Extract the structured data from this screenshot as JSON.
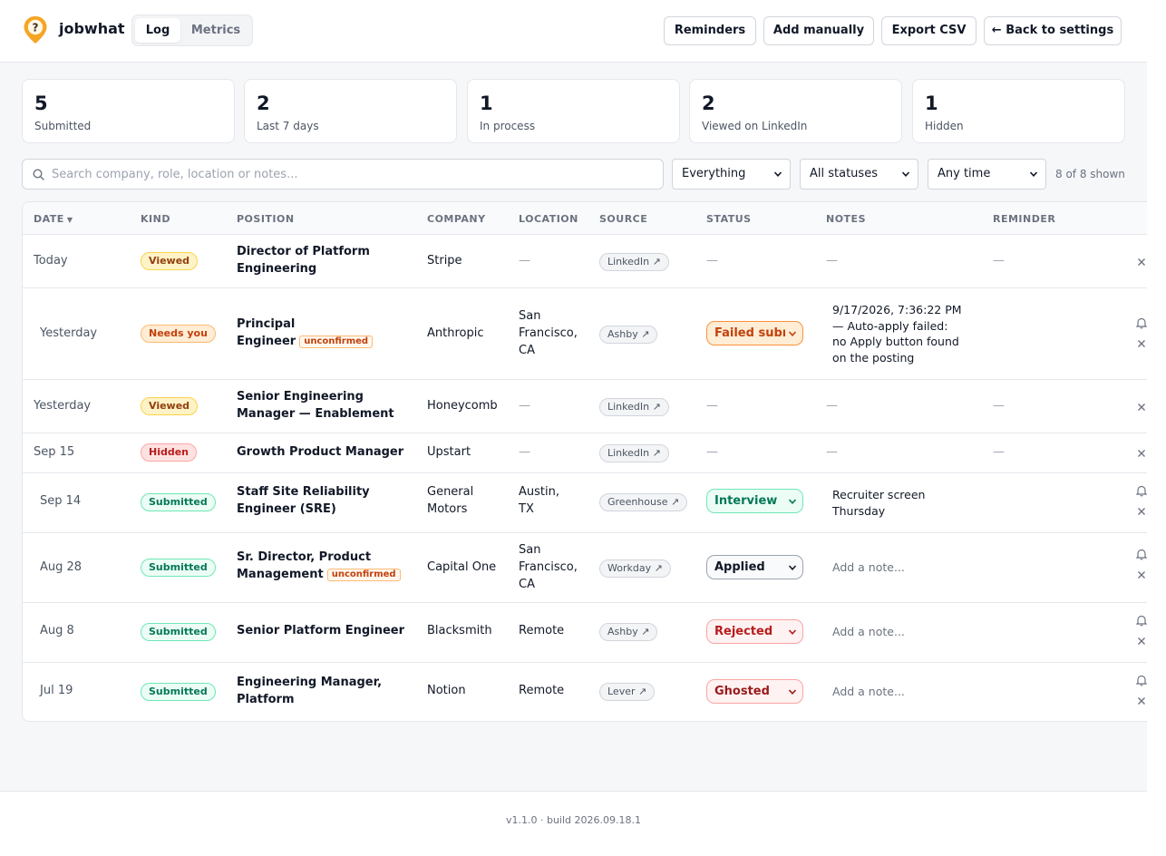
{
  "header": {
    "brand": "jobwhat",
    "tabs": [
      {
        "label": "Log",
        "active": true
      },
      {
        "label": "Metrics",
        "active": false
      }
    ],
    "buttons": {
      "reminders": "Reminders",
      "add_manually": "Add manually",
      "export_csv": "Export CSV",
      "back": "← Back to settings"
    }
  },
  "stats": [
    {
      "value": "5",
      "label": "Submitted"
    },
    {
      "value": "2",
      "label": "Last 7 days"
    },
    {
      "value": "1",
      "label": "In process"
    },
    {
      "value": "2",
      "label": "Viewed on LinkedIn"
    },
    {
      "value": "1",
      "label": "Hidden"
    }
  ],
  "filters": {
    "search_placeholder": "Search company, role, location or notes...",
    "kind": "Everything",
    "status": "All statuses",
    "time": "Any time",
    "shown": "8 of 8 shown"
  },
  "table": {
    "columns": {
      "date": "DATE",
      "kind": "KIND",
      "position": "POSITION",
      "company": "COMPANY",
      "location": "LOCATION",
      "source": "SOURCE",
      "status": "STATUS",
      "notes": "NOTES",
      "reminder": "REMINDER"
    },
    "sort_indicator": "▼",
    "unconfirmed_label": "unconfirmed",
    "dash": "—",
    "rows": [
      {
        "date": "Today",
        "kind": "Viewed",
        "position_lines": [
          "Director of Platform",
          "Engineering"
        ],
        "company_lines": [
          "Stripe"
        ],
        "location_lines": [
          "—"
        ],
        "source": "LinkedIn ↗",
        "status": "—",
        "notes_lines": [
          "—"
        ],
        "reminder": "—"
      },
      {
        "date": "Yesterday",
        "kind": "Needs you",
        "position_lines": [
          "Principal",
          "Engineer"
        ],
        "company_lines": [
          "Anthropic"
        ],
        "location_lines": [
          "San",
          "Francisco,",
          "CA"
        ],
        "source": "Ashby ↗",
        "status": "Failed submission",
        "notes_lines": [
          "9/17/2026, 7:36:22 PM",
          "— Auto-apply failed:",
          "no Apply button found",
          "on the posting"
        ],
        "reminder": ""
      },
      {
        "date": "Yesterday",
        "kind": "Viewed",
        "position_lines": [
          "Senior Engineering",
          "Manager — Enablement"
        ],
        "company_lines": [
          "Honeycomb"
        ],
        "location_lines": [
          "—"
        ],
        "source": "LinkedIn ↗",
        "status": "—",
        "notes_lines": [
          "—"
        ],
        "reminder": "—"
      },
      {
        "date": "Sep 15",
        "kind": "Hidden",
        "position_lines": [
          "Growth Product Manager"
        ],
        "company_lines": [
          "Upstart"
        ],
        "location_lines": [
          "—"
        ],
        "source": "LinkedIn ↗",
        "status": "—",
        "notes_lines": [
          "—"
        ],
        "reminder": "—"
      },
      {
        "date": "Sep 14",
        "kind": "Submitted",
        "position_lines": [
          "Staff Site Reliability",
          "Engineer (SRE)"
        ],
        "company_lines": [
          "General",
          "Motors"
        ],
        "location_lines": [
          "Austin,",
          "TX"
        ],
        "source": "Greenhouse ↗",
        "status": "Interview",
        "notes_lines": [
          "Recruiter screen",
          "Thursday"
        ],
        "reminder": ""
      },
      {
        "date": "Aug 28",
        "kind": "Submitted",
        "position_lines": [
          "Sr. Director, Product",
          "Management"
        ],
        "company_lines": [
          "Capital One"
        ],
        "location_lines": [
          "San",
          "Francisco,",
          "CA"
        ],
        "source": "Workday ↗",
        "status": "Applied",
        "notes_placeholder": "Add a note...",
        "reminder": ""
      },
      {
        "date": "Aug 8",
        "kind": "Submitted",
        "position_lines": [
          "Senior Platform Engineer"
        ],
        "company_lines": [
          "Blacksmith"
        ],
        "location_lines": [
          "Remote"
        ],
        "source": "Ashby ↗",
        "status": "Rejected",
        "notes_placeholder": "Add a note...",
        "reminder": ""
      },
      {
        "date": "Jul 19",
        "kind": "Submitted",
        "position_lines": [
          "Engineering Manager,",
          "Platform"
        ],
        "company_lines": [
          "Notion"
        ],
        "location_lines": [
          "Remote"
        ],
        "source": "Lever ↗",
        "status": "Ghosted",
        "notes_placeholder": "Add a note...",
        "reminder": ""
      }
    ]
  },
  "footer": {
    "version": "v1.1.0 · build 2026.09.18.1"
  },
  "colors": {
    "accent": "#f59e0b",
    "brand_pin": "#f5a524",
    "border": "#e5e7eb"
  }
}
